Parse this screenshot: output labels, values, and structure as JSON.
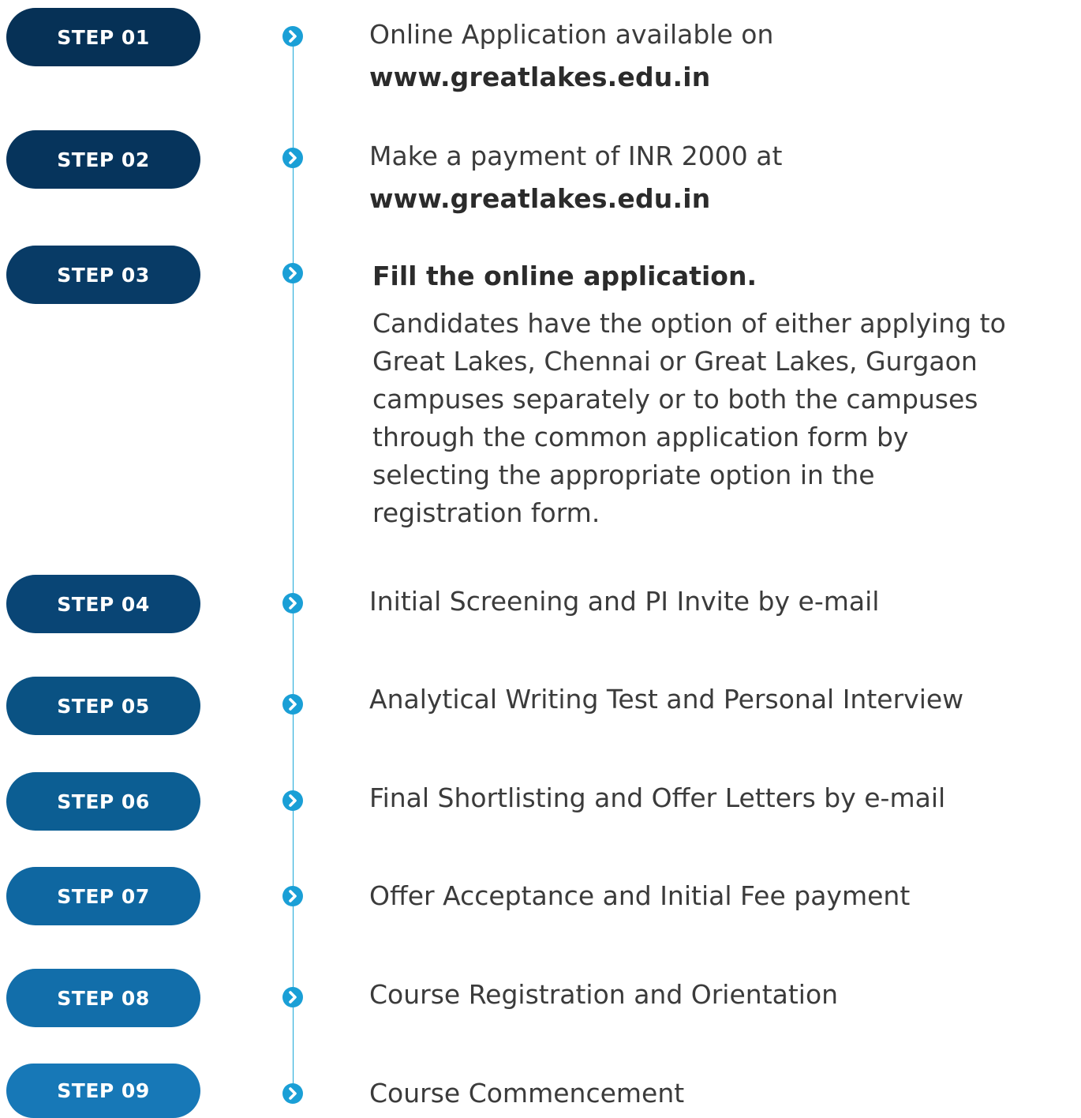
{
  "steps": [
    {
      "badge": "STEP 01",
      "color": "#063156",
      "text": "Online Application available on",
      "link": "www.greatlakes.edu.in"
    },
    {
      "badge": "STEP 02",
      "color": "#06345c",
      "text": "Make a payment of INR 2000 at",
      "link": "www.greatlakes.edu.in"
    },
    {
      "badge": "STEP 03",
      "color": "#083b66",
      "heading": "Fill the online application.",
      "paragraph_lines": [
        "Candidates have the option of either applying to",
        "Great Lakes, Chennai or Great Lakes, Gurgaon",
        "campuses separately or to both the campuses",
        "through the common application form by",
        "selecting the appropriate option in the",
        "registration form."
      ]
    },
    {
      "badge": "STEP 04",
      "color": "#094575",
      "text": "Initial Screening and PI Invite by e-mail"
    },
    {
      "badge": "STEP 05",
      "color": "#0a5283",
      "text": "Analytical Writing Test and Personal Interview"
    },
    {
      "badge": "STEP 06",
      "color": "#0c5e93",
      "text": "Final Shortlisting and Offer Letters by e-mail"
    },
    {
      "badge": "STEP 07",
      "color": "#0f67a1",
      "text": "Offer Acceptance and Initial Fee payment"
    },
    {
      "badge": "STEP 08",
      "color": "#126eaa",
      "text": "Course Registration and Orientation"
    },
    {
      "badge": "STEP 09",
      "color": "#1778b7",
      "text": "Course Commencement"
    }
  ],
  "colors": {
    "line": "#1ba8d8",
    "bullet": "#1a9fd6"
  },
  "icons": {
    "bullet": "chevron-right-icon"
  }
}
